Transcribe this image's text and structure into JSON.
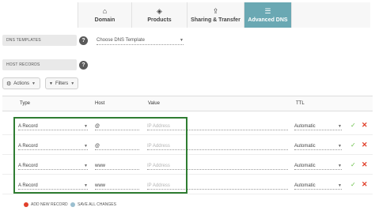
{
  "tabs": [
    {
      "label": "Domain",
      "icon": "home-icon",
      "glyph": "⌂"
    },
    {
      "label": "Products",
      "icon": "box-icon",
      "glyph": "◈"
    },
    {
      "label": "Sharing & Transfer",
      "icon": "share-icon",
      "glyph": "⇪"
    },
    {
      "label": "Advanced DNS",
      "icon": "dns-icon",
      "glyph": "☰",
      "active": true
    }
  ],
  "dns_templates": {
    "label": "DNS TEMPLATES",
    "help": "?",
    "select_value": "Choose DNS Template",
    "caret": "▼"
  },
  "host_records": {
    "label": "HOST RECORDS",
    "help": "?"
  },
  "actions_button": {
    "label": "Actions",
    "icon_glyph": "⚙",
    "caret": "▼"
  },
  "filters_button": {
    "label": "Filters",
    "icon_glyph": "▼",
    "caret": "▼"
  },
  "table": {
    "headers": {
      "type": "Type",
      "host": "Host",
      "value": "Value",
      "ttl": "TTL"
    },
    "rows": [
      {
        "type": "A Record",
        "host": "@",
        "value_placeholder": "IP Address",
        "ttl": "Automatic"
      },
      {
        "type": "A Record",
        "host": "@",
        "value_placeholder": "IP Address",
        "ttl": "Automatic"
      },
      {
        "type": "A Record",
        "host": "www",
        "value_placeholder": "IP Address",
        "ttl": "Automatic"
      },
      {
        "type": "A Record",
        "host": "www",
        "value_placeholder": "IP Address",
        "ttl": "Automatic"
      }
    ],
    "caret": "▼",
    "check": "✓",
    "remove": "✕"
  },
  "footer": {
    "add_record": "ADD NEW RECORD",
    "save_all": "SAVE ALL CHANGES",
    "add_color": "#e1402b",
    "save_color": "#9bbfd0"
  },
  "colors": {
    "accent": "#6aa8b3",
    "highlight_box": "#2f7d32"
  }
}
